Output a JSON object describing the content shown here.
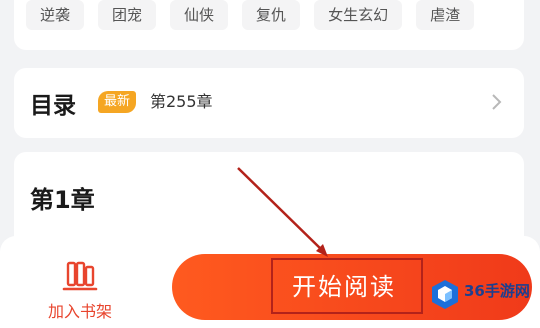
{
  "tags": [
    "逆袭",
    "团宠",
    "仙侠",
    "复仇",
    "女生玄幻",
    "虐渣"
  ],
  "toc": {
    "title": "目录",
    "badge": "最新",
    "latest_chapter": "第255章"
  },
  "chapter": {
    "title": "第1章"
  },
  "bottom": {
    "add_shelf_label": "加入书架",
    "start_read_label": "开始阅读"
  },
  "watermark": {
    "text": "36手游网"
  },
  "colors": {
    "accent": "#f03a1a",
    "badge": "#f5a623",
    "annotation": "#b3221a"
  }
}
